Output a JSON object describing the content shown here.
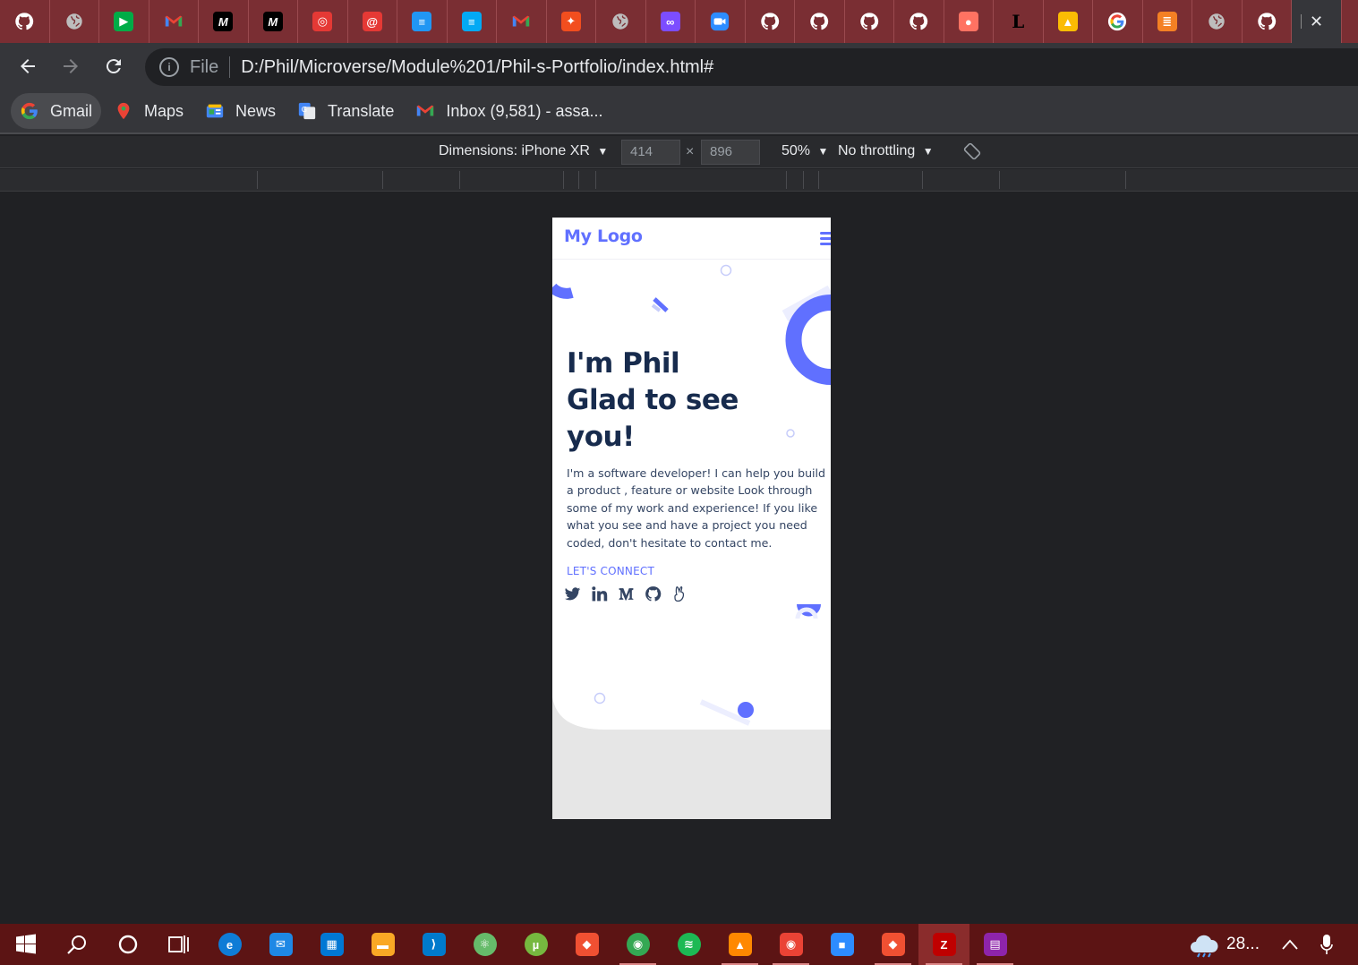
{
  "browser": {
    "tabs": [
      {
        "icon": "github-icon",
        "color": "#ffffff"
      },
      {
        "icon": "globe-icon",
        "color": "#bdbdbd"
      },
      {
        "icon": "google-meet-icon",
        "color": "#00ac47"
      },
      {
        "icon": "gmail-icon",
        "color": "#ea4335"
      },
      {
        "icon": "medium-icon",
        "color": "#000000"
      },
      {
        "icon": "medium-icon",
        "color": "#000000"
      },
      {
        "icon": "target-icon",
        "color": "#e53935"
      },
      {
        "icon": "at-sign-icon",
        "color": "#e53935"
      },
      {
        "icon": "docs-lines-icon",
        "color": "#2196f3"
      },
      {
        "icon": "docs-lines-icon",
        "color": "#03a9f4"
      },
      {
        "icon": "gmail-icon",
        "color": "#ea4335"
      },
      {
        "icon": "figma-icon",
        "color": "#f24e1e"
      },
      {
        "icon": "globe-icon",
        "color": "#bdbdbd"
      },
      {
        "icon": "infinity-icon",
        "color": "#7c4dff"
      },
      {
        "icon": "zoom-icon",
        "color": "#2d8cff"
      },
      {
        "icon": "github-icon",
        "color": "#ffffff"
      },
      {
        "icon": "github-icon",
        "color": "#ffffff"
      },
      {
        "icon": "github-icon",
        "color": "#ffffff"
      },
      {
        "icon": "github-icon",
        "color": "#ffffff"
      },
      {
        "icon": "figma-pink-icon",
        "color": "#ff7262"
      },
      {
        "icon": "letter-l-icon",
        "color": "#000000"
      },
      {
        "icon": "google-drive-icon",
        "color": "#fbbc04"
      },
      {
        "icon": "google-icon",
        "color": "#4285f4"
      },
      {
        "icon": "stackoverflow-icon",
        "color": "#f48024"
      },
      {
        "icon": "globe-icon",
        "color": "#bdbdbd"
      },
      {
        "icon": "github-icon",
        "color": "#ffffff"
      }
    ],
    "address": {
      "scheme": "File",
      "url": "D:/Phil/Microverse/Module%201/Phil-s-Portfolio/index.html#"
    },
    "bookmarks": [
      {
        "label": "Gmail",
        "icon": "google-icon"
      },
      {
        "label": "Maps",
        "icon": "maps-pin-icon"
      },
      {
        "label": "News",
        "icon": "news-icon"
      },
      {
        "label": "Translate",
        "icon": "translate-icon"
      },
      {
        "label": "Inbox (9,581) - assa...",
        "icon": "gmail-icon"
      }
    ]
  },
  "devtools": {
    "dimensions_label": "Dimensions: iPhone XR",
    "width_value": "414",
    "height_value": "896",
    "times": "×",
    "zoom": "50%",
    "throttling": "No throttling"
  },
  "page": {
    "logo": "My Logo",
    "headline_line1": "I'm Phil",
    "headline_line2": "Glad to see",
    "headline_line3": "you!",
    "intro": "I'm a software developer! I can help you build a product , feature or website Look through some of my work and experience! If you like what you see and have a project you need coded, don't hesitate to contact me.",
    "connect": "LET'S CONNECT",
    "social": [
      "twitter-icon",
      "linkedin-icon",
      "medium-icon",
      "github-icon",
      "angellist-icon"
    ],
    "accent": "#6070ff",
    "heading_color": "#172b4d"
  },
  "taskbar": {
    "apps": [
      "windows-start-icon",
      "search-icon",
      "cortana-icon",
      "task-view-icon",
      "edge-icon",
      "mail-icon",
      "store-icon",
      "file-explorer-icon",
      "vscode-icon",
      "atom-icon",
      "utorrent-icon",
      "git-icon",
      "chrome-icon",
      "spotify-icon",
      "vlc-icon",
      "chrome-profile-icon",
      "zoom-icon",
      "git-gui-icon",
      "filezilla-icon",
      "winrar-icon"
    ],
    "weather": "28...",
    "background": "#5c1414"
  }
}
